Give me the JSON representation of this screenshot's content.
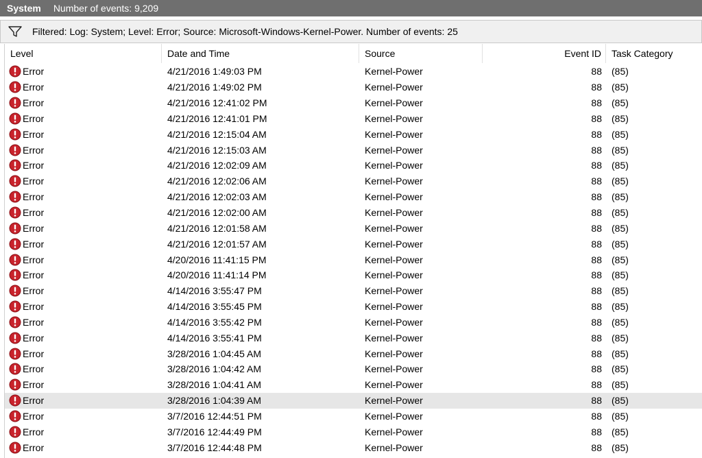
{
  "titlebar": {
    "title": "System",
    "event_count": "Number of events: 9,209"
  },
  "filter": {
    "icon": "funnel-icon",
    "text": "Filtered: Log: System; Level: Error; Source: Microsoft-Windows-Kernel-Power. Number of events: 25"
  },
  "columns": {
    "level": "Level",
    "date": "Date and Time",
    "source": "Source",
    "event_id": "Event ID",
    "task_category": "Task Category"
  },
  "colors": {
    "error_icon": "#c8232c",
    "selected_row": "#e6e6e6",
    "titlebar": "#6f6f6f"
  },
  "selected_row_index": 21,
  "rows": [
    {
      "level": "Error",
      "date": "4/21/2016 1:49:03 PM",
      "source": "Kernel-Power",
      "event_id": "88",
      "task_category": "(85)"
    },
    {
      "level": "Error",
      "date": "4/21/2016 1:49:02 PM",
      "source": "Kernel-Power",
      "event_id": "88",
      "task_category": "(85)"
    },
    {
      "level": "Error",
      "date": "4/21/2016 12:41:02 PM",
      "source": "Kernel-Power",
      "event_id": "88",
      "task_category": "(85)"
    },
    {
      "level": "Error",
      "date": "4/21/2016 12:41:01 PM",
      "source": "Kernel-Power",
      "event_id": "88",
      "task_category": "(85)"
    },
    {
      "level": "Error",
      "date": "4/21/2016 12:15:04 AM",
      "source": "Kernel-Power",
      "event_id": "88",
      "task_category": "(85)"
    },
    {
      "level": "Error",
      "date": "4/21/2016 12:15:03 AM",
      "source": "Kernel-Power",
      "event_id": "88",
      "task_category": "(85)"
    },
    {
      "level": "Error",
      "date": "4/21/2016 12:02:09 AM",
      "source": "Kernel-Power",
      "event_id": "88",
      "task_category": "(85)"
    },
    {
      "level": "Error",
      "date": "4/21/2016 12:02:06 AM",
      "source": "Kernel-Power",
      "event_id": "88",
      "task_category": "(85)"
    },
    {
      "level": "Error",
      "date": "4/21/2016 12:02:03 AM",
      "source": "Kernel-Power",
      "event_id": "88",
      "task_category": "(85)"
    },
    {
      "level": "Error",
      "date": "4/21/2016 12:02:00 AM",
      "source": "Kernel-Power",
      "event_id": "88",
      "task_category": "(85)"
    },
    {
      "level": "Error",
      "date": "4/21/2016 12:01:58 AM",
      "source": "Kernel-Power",
      "event_id": "88",
      "task_category": "(85)"
    },
    {
      "level": "Error",
      "date": "4/21/2016 12:01:57 AM",
      "source": "Kernel-Power",
      "event_id": "88",
      "task_category": "(85)"
    },
    {
      "level": "Error",
      "date": "4/20/2016 11:41:15 PM",
      "source": "Kernel-Power",
      "event_id": "88",
      "task_category": "(85)"
    },
    {
      "level": "Error",
      "date": "4/20/2016 11:41:14 PM",
      "source": "Kernel-Power",
      "event_id": "88",
      "task_category": "(85)"
    },
    {
      "level": "Error",
      "date": "4/14/2016 3:55:47 PM",
      "source": "Kernel-Power",
      "event_id": "88",
      "task_category": "(85)"
    },
    {
      "level": "Error",
      "date": "4/14/2016 3:55:45 PM",
      "source": "Kernel-Power",
      "event_id": "88",
      "task_category": "(85)"
    },
    {
      "level": "Error",
      "date": "4/14/2016 3:55:42 PM",
      "source": "Kernel-Power",
      "event_id": "88",
      "task_category": "(85)"
    },
    {
      "level": "Error",
      "date": "4/14/2016 3:55:41 PM",
      "source": "Kernel-Power",
      "event_id": "88",
      "task_category": "(85)"
    },
    {
      "level": "Error",
      "date": "3/28/2016 1:04:45 AM",
      "source": "Kernel-Power",
      "event_id": "88",
      "task_category": "(85)"
    },
    {
      "level": "Error",
      "date": "3/28/2016 1:04:42 AM",
      "source": "Kernel-Power",
      "event_id": "88",
      "task_category": "(85)"
    },
    {
      "level": "Error",
      "date": "3/28/2016 1:04:41 AM",
      "source": "Kernel-Power",
      "event_id": "88",
      "task_category": "(85)"
    },
    {
      "level": "Error",
      "date": "3/28/2016 1:04:39 AM",
      "source": "Kernel-Power",
      "event_id": "88",
      "task_category": "(85)"
    },
    {
      "level": "Error",
      "date": "3/7/2016 12:44:51 PM",
      "source": "Kernel-Power",
      "event_id": "88",
      "task_category": "(85)"
    },
    {
      "level": "Error",
      "date": "3/7/2016 12:44:49 PM",
      "source": "Kernel-Power",
      "event_id": "88",
      "task_category": "(85)"
    },
    {
      "level": "Error",
      "date": "3/7/2016 12:44:48 PM",
      "source": "Kernel-Power",
      "event_id": "88",
      "task_category": "(85)"
    }
  ]
}
